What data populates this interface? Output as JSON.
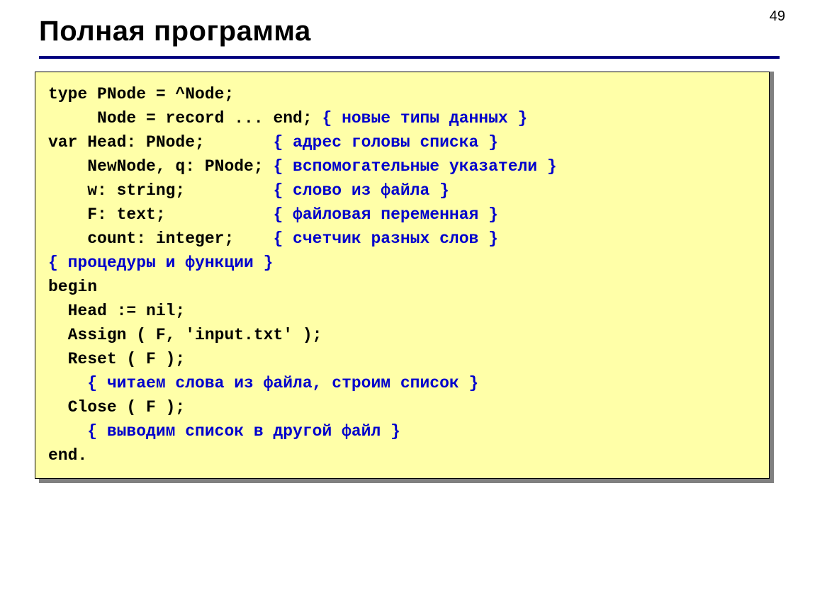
{
  "page_number": "49",
  "title": "Полная программа",
  "code": {
    "l1a": "type PNode = ^Node;",
    "l2a": "     Node = record ... end; ",
    "l2b": "{ новые типы данных }",
    "l3a": "var Head: PNode;       ",
    "l3b": "{ адрес головы списка }",
    "l4a": "    NewNode, q: PNode; ",
    "l4b": "{ вспомогательные указатели }",
    "l5a": "    w: string;         ",
    "l5b": "{ слово из файла }",
    "l6a": "    F: text;           ",
    "l6b": "{ файловая переменная }",
    "l7a": "    count: integer;    ",
    "l7b": "{ счетчик разных слов }",
    "l8": "{ процедуры и функции }",
    "l9": "begin",
    "l10": "  Head := nil;",
    "l11": "  Assign ( F, 'input.txt' );",
    "l12": "  Reset ( F );",
    "l13": "    { читаем слова из файла, строим список }",
    "l14": "  Close ( F );",
    "l15": "    { выводим список в другой файл }",
    "l16": "end."
  }
}
